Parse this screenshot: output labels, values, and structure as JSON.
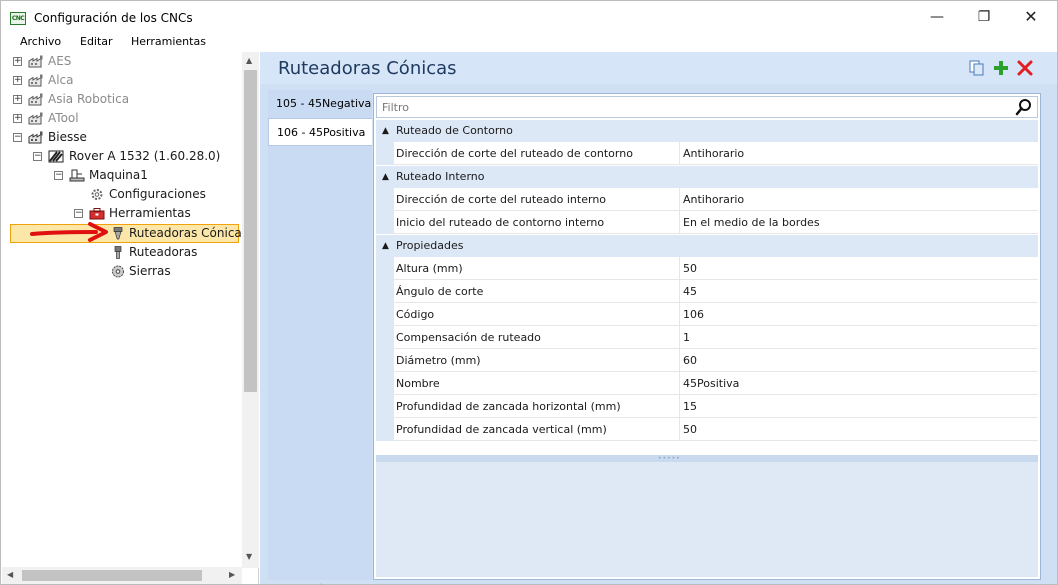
{
  "window": {
    "app_icon_text": "CNC",
    "title": "Configuración de los CNCs",
    "minimize_glyph": "—",
    "maximize_glyph": "❐",
    "close_glyph": "✕"
  },
  "menu": {
    "items": [
      "Archivo",
      "Editar",
      "Herramientas"
    ]
  },
  "tree": {
    "nodes": [
      {
        "label": "AES",
        "icon": "factory-icon",
        "muted": true
      },
      {
        "label": "Alca",
        "icon": "factory-icon",
        "muted": true
      },
      {
        "label": "Asia Robotica",
        "icon": "factory-icon",
        "muted": true
      },
      {
        "label": "ATool",
        "icon": "factory-icon",
        "muted": true
      },
      {
        "label": "Biesse",
        "icon": "factory-icon",
        "muted": false
      },
      {
        "label": "Rover A 1532 (1.60.28.0)",
        "icon": "cnc-machine-icon",
        "muted": false
      },
      {
        "label": "Maquina1",
        "icon": "machine-icon",
        "muted": false
      },
      {
        "label": "Configuraciones",
        "icon": "gear-icon",
        "muted": false
      },
      {
        "label": "Herramientas",
        "icon": "toolbox-icon",
        "muted": false
      },
      {
        "label": "Ruteadoras Cónicas",
        "icon": "conical-router-icon",
        "muted": false,
        "selected": true
      },
      {
        "label": "Ruteadoras",
        "icon": "router-bit-icon",
        "muted": false
      },
      {
        "label": "Sierras",
        "icon": "saw-blade-icon",
        "muted": false
      }
    ]
  },
  "main": {
    "title": "Ruteadoras Cónicas",
    "header_icons": [
      "copy-icon",
      "add-icon",
      "delete-icon"
    ],
    "accent_color": "#2ca02c",
    "delete_color": "#e02020",
    "tabs": [
      {
        "label": "105 - 45Negativa",
        "active": false
      },
      {
        "label": "106 - 45Positiva",
        "active": true
      }
    ],
    "filter_placeholder": "Filtro",
    "categories": [
      {
        "name": "Ruteado de Contorno",
        "rows": [
          {
            "name": "Dirección de corte del ruteado de contorno",
            "value": "Antihorario"
          }
        ]
      },
      {
        "name": "Ruteado Interno",
        "rows": [
          {
            "name": "Dirección de corte del ruteado interno",
            "value": "Antihorario"
          },
          {
            "name": "Inicio del ruteado de contorno interno",
            "value": "En el medio de la bordes"
          }
        ]
      },
      {
        "name": "Propiedades",
        "rows": [
          {
            "name": "Altura (mm)",
            "value": "50"
          },
          {
            "name": "Ángulo de corte",
            "value": "45"
          },
          {
            "name": "Código",
            "value": "106"
          },
          {
            "name": "Compensación de ruteado",
            "value": "1"
          },
          {
            "name": "Diámetro (mm)",
            "value": "60"
          },
          {
            "name": "Nombre",
            "value": "45Positiva"
          },
          {
            "name": "Profundidad de zancada horizontal (mm)",
            "value": "15"
          },
          {
            "name": "Profundidad de zancada vertical (mm)",
            "value": "50"
          }
        ]
      }
    ]
  }
}
